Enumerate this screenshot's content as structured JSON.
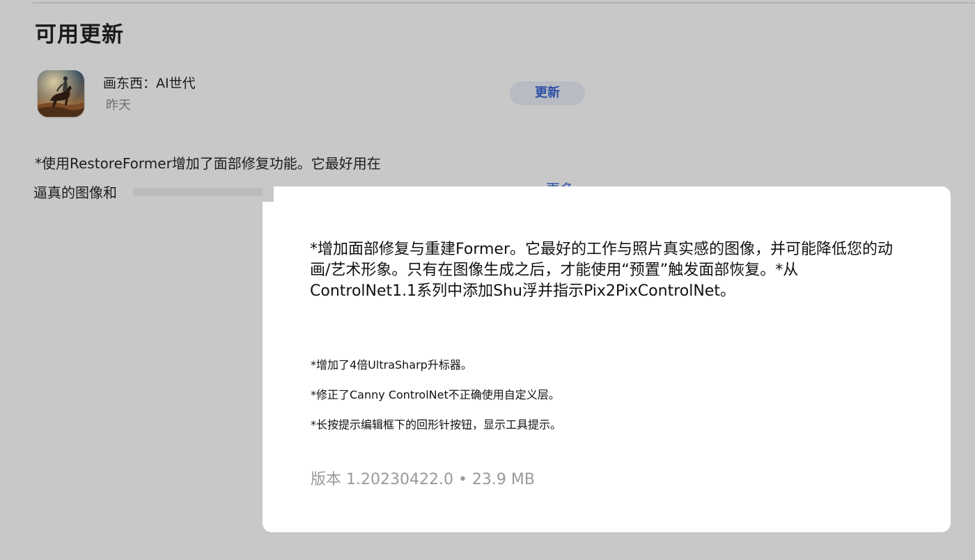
{
  "section": {
    "title": "可用更新"
  },
  "app": {
    "name": "画东西：AI世代",
    "date": "昨天",
    "icon": "horse-rider-app-icon",
    "update_label": "更新"
  },
  "preview": {
    "line1": "*使用RestoreFormer增加了面部修复功能。它最好用在",
    "line2": "逼真的图像和",
    "more_label": "更多"
  },
  "details": {
    "lead": "*增加面部修复与重建Former。它最好的工作与照片真实感的图像，并可能降低您的动画/艺术形象。只有在图像生成之后，才能使用“预置”触发面部恢复。*从ControlNet1.1系列中添加Shu浮并指示Pix2PixControlNet。",
    "notes": [
      "*增加了4倍UltraSharp升标器。",
      "*修正了Canny ControlNet不正确使用自定义层。",
      "*长按提示编辑框下的回形针按钮，显示工具提示。"
    ],
    "version_line": "版本 1.20230422.0 • 23.9 MB"
  },
  "colors": {
    "background": "#c8c8c9",
    "accent": "#2c4fa6",
    "card": "#ffffff"
  }
}
